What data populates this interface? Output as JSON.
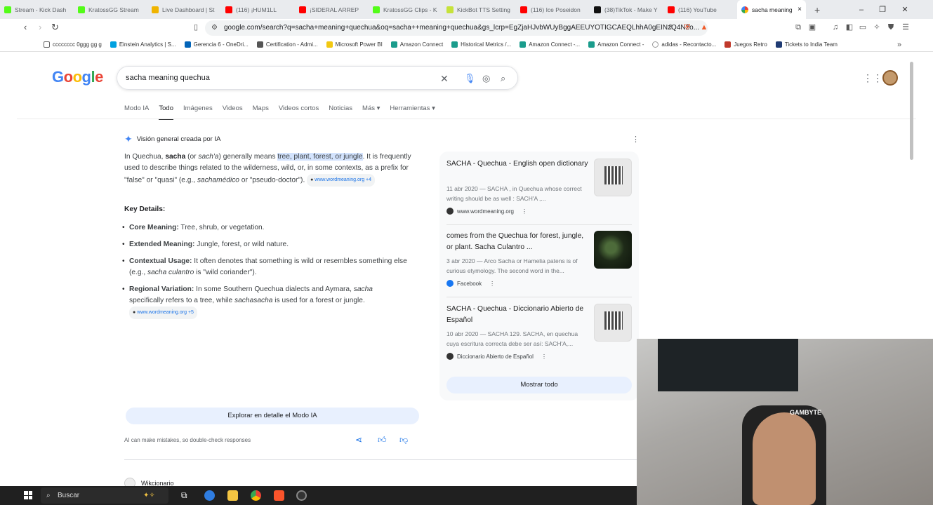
{
  "browser": {
    "tabs": [
      {
        "label": "Stream - Kick Dash",
        "color": "#53fc18"
      },
      {
        "label": "KratossGG Stream",
        "color": "#53fc18"
      },
      {
        "label": "Live Dashboard | St",
        "color": "#f0b400"
      },
      {
        "label": "(116) ¡HUM1LL",
        "color": "#ff0000"
      },
      {
        "label": "¡SIDERAL ARREP",
        "color": "#ff0000"
      },
      {
        "label": "KratossGG Clips - K",
        "color": "#53fc18"
      },
      {
        "label": "KickBot TTS Setting",
        "color": "#c6e23a"
      },
      {
        "label": "(116) Ice Poseidon",
        "color": "#ff0000"
      },
      {
        "label": "(38)TikTok - Make Y",
        "color": "#111111"
      },
      {
        "label": "(116) YouTube",
        "color": "#ff0000"
      }
    ],
    "active_tab": {
      "label": "sacha meaning",
      "close": "×"
    },
    "new_tab": "+",
    "window_controls": {
      "minimize": "–",
      "restore": "❐",
      "close": "✕"
    },
    "url": "google.com/search?q=sacha+meaning+quechua&oq=sacha++meaning+quechua&gs_lcrp=EgZjaHJvbWUyBggAEEUYOTIGCAEQLhhA0gEINzQ4N2o...",
    "bookmarks": [
      {
        "label": "cccccccc 0ggg gg  g",
        "color": "#888888"
      },
      {
        "label": "Einstein Analytics | S...",
        "color": "#00a1e0"
      },
      {
        "label": "Gerencia 6 - OneDri...",
        "color": "#0364b8"
      },
      {
        "label": "Certification - Admi...",
        "color": "#555555"
      },
      {
        "label": "Microsoft Power BI",
        "color": "#f2c811"
      },
      {
        "label": "Amazon Connect",
        "color": "#1a9c8c"
      },
      {
        "label": "Historical Metrics /...",
        "color": "#1a9c8c"
      },
      {
        "label": "Amazon Connect -...",
        "color": "#1a9c8c"
      },
      {
        "label": "Amazon Connect -",
        "color": "#1a9c8c"
      },
      {
        "label": "adidas - Recontacto...",
        "color": "#999999"
      },
      {
        "label": "Juegos Retro",
        "color": "#c0392b"
      },
      {
        "label": "Tickets to India Team",
        "color": "#1f3b73"
      }
    ]
  },
  "google": {
    "logo": "Google",
    "query": "sacha meaning quechua",
    "tabs": [
      "Modo IA",
      "Todo",
      "Imágenes",
      "Videos",
      "Maps",
      "Videos cortos",
      "Noticias",
      "Más ▾",
      "Herramientas ▾"
    ],
    "active_tab": "Todo"
  },
  "ai_overview": {
    "header": "Visión general creada por IA",
    "intro": {
      "p1": "In Quechua, ",
      "b1": "sacha",
      "p2": " (or ",
      "i1": "sach'a",
      "p3": ") generally means ",
      "hl": "tree, plant, forest, or jungle",
      "p4": ". It is frequently used to describe things related to the wilderness, wild, or, in some contexts, as a prefix for \"false\" or \"quasi\" (e.g., ",
      "i2": "sachamédico",
      "p5": " or \"pseudo-doctor\"). ",
      "src": "www.wordmeaning.org +4"
    },
    "key_details": "Key Details:",
    "bullets": [
      {
        "term": "Core Meaning:",
        "text": " Tree, shrub, or vegetation."
      },
      {
        "term": "Extended Meaning:",
        "text": " Jungle, forest, or wild nature."
      },
      {
        "term": "Contextual Usage:",
        "text": " It often denotes that something is wild or resembles something else (e.g., ",
        "ital": "sacha culantro",
        "text2": " is \"wild coriander\")."
      },
      {
        "term": "Regional Variation:",
        "text": " In some Southern Quechua dialects and Aymara, ",
        "ital": "sacha",
        "text2": " specifically refers to a tree, while ",
        "ital2": "sachasacha",
        "text3": " is used for a forest or jungle. ",
        "src": "www.wordmeaning.org +5"
      }
    ],
    "explore_button": "Explorar en detalle el Modo IA",
    "disclaimer": "AI can make mistakes, so double-check responses",
    "sources": [
      {
        "title": "SACHA - Quechua - English open dictionary",
        "snippet": "11 abr 2020 — SACHA , in Quechua whose correct writing should be as well : SACH'A ,...",
        "site": "www.wordmeaning.org"
      },
      {
        "title": "comes from the Quechua for forest, jungle, or plant. Sacha Culantro ...",
        "snippet": "3 abr 2020 — Arco Sacha or Hamelia patens is of curious etymology. The second word in the...",
        "site": "Facebook"
      },
      {
        "title": "SACHA - Quechua - Diccionario Abierto de Español",
        "snippet": "10 abr 2020 — SACHA 129. SACHA, en quechua cuya escritura correcta debe ser así: SACH'A,...",
        "site": "Diccionario Abierto de Español"
      }
    ],
    "show_all": "Mostrar todo"
  },
  "next_result": "Wikcionario",
  "webcam": {
    "brand_text": "GAMBYTE"
  },
  "taskbar": {
    "search": "Buscar"
  }
}
